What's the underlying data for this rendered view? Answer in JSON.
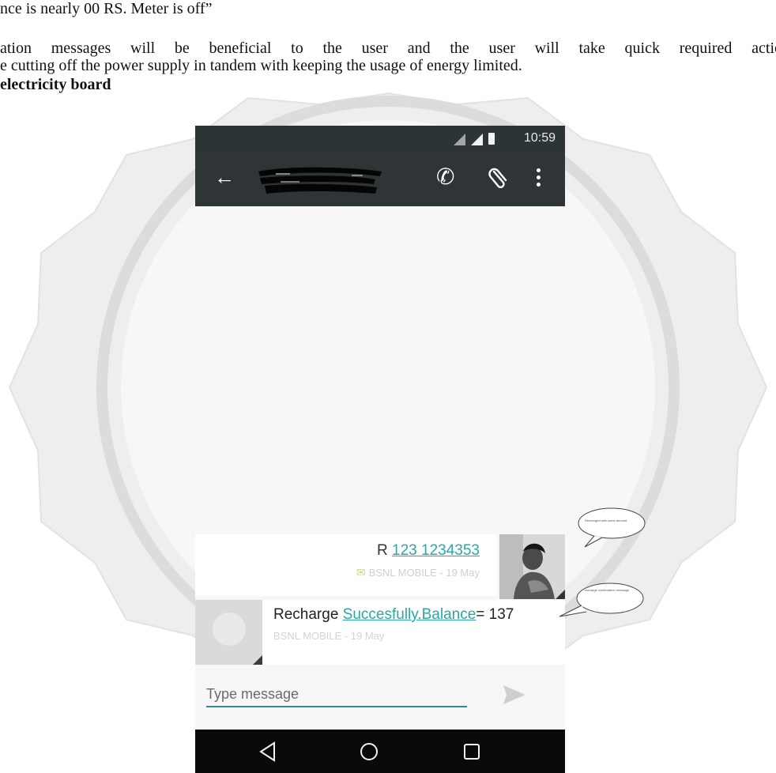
{
  "document": {
    "line1": "nce is nearly 00 RS. Meter is off”",
    "line2": "ation messages will be beneficial to the user and the user will take quick required actio",
    "line3": "e cutting off the power supply in tandem with keeping the usage of energy limited.",
    "line4": "electricity board"
  },
  "phone": {
    "status_bar": {
      "time": "10:59",
      "icons": [
        "signal-icon",
        "signal-icon",
        "battery-icon"
      ]
    },
    "app_bar": {
      "icons": [
        "back-arrow-icon",
        "phone-call-icon",
        "attachment-icon",
        "more-vert-icon"
      ]
    },
    "messages": [
      {
        "type": "sent",
        "prefix": "R ",
        "number": "123 1234353",
        "meta": "BSNL MOBILE - 19 May"
      },
      {
        "type": "received",
        "prefix": "Recharge ",
        "link": "Succesfully.Balance",
        "suffix": "= 137",
        "meta": "BSNL MOBILE - 19 May"
      }
    ],
    "composer": {
      "placeholder": "Type message"
    },
    "nav_bar": {
      "icons": [
        "back-triangle-icon",
        "home-circle-icon",
        "recents-square-icon"
      ]
    }
  },
  "annotations": {
    "callout1": "Recharged with some amount",
    "callout2": "recharge confirmation message"
  },
  "colors": {
    "appbar": "#2f3537",
    "link": "#2aa7a7",
    "navbar": "#0a0a0a",
    "composer_underline": "#2b8d8d"
  }
}
